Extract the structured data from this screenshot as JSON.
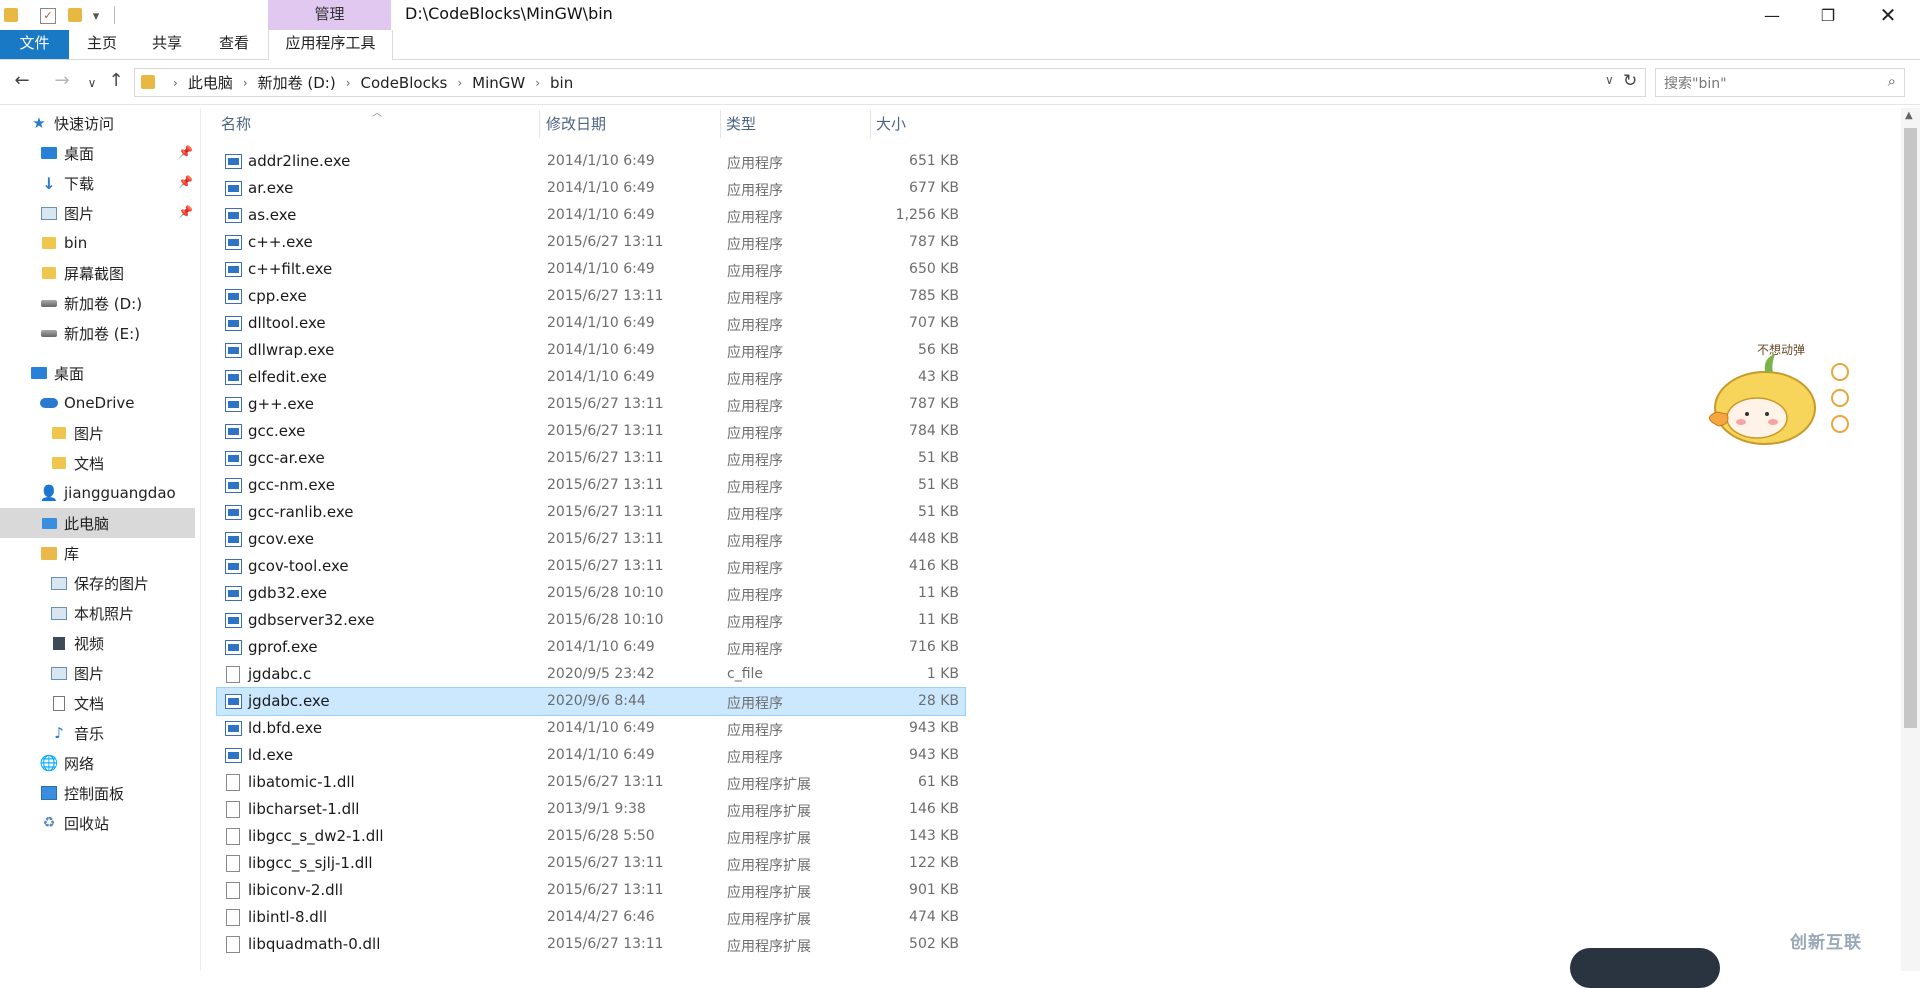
{
  "window": {
    "title": "D:\\CodeBlocks\\MinGW\\bin",
    "manage_tab": "管理"
  },
  "ribbon": {
    "tabs": [
      "文件",
      "主页",
      "共享",
      "查看",
      "应用程序工具"
    ]
  },
  "address": {
    "crumbs": [
      "此电脑",
      "新加卷 (D:)",
      "CodeBlocks",
      "MinGW",
      "bin"
    ],
    "search_placeholder": "搜索\"bin\""
  },
  "sidebar": {
    "items": [
      {
        "label": "快速访问",
        "icon": "star-icon"
      },
      {
        "label": "桌面",
        "icon": "desktop-icon",
        "pinned": true
      },
      {
        "label": "下载",
        "icon": "download-icon",
        "pinned": true
      },
      {
        "label": "图片",
        "icon": "pictures-icon",
        "pinned": true
      },
      {
        "label": "bin",
        "icon": "folder-icon"
      },
      {
        "label": "屏幕截图",
        "icon": "folder-icon"
      },
      {
        "label": "新加卷 (D:)",
        "icon": "drive-icon"
      },
      {
        "label": "新加卷 (E:)",
        "icon": "drive-icon"
      },
      {
        "label": "桌面",
        "icon": "desktop-icon"
      },
      {
        "label": "OneDrive",
        "icon": "cloud-icon"
      },
      {
        "label": "图片",
        "icon": "folder-icon"
      },
      {
        "label": "文档",
        "icon": "folder-icon"
      },
      {
        "label": "jiangguangdao",
        "icon": "user-icon"
      },
      {
        "label": "此电脑",
        "icon": "computer-icon",
        "selected": true
      },
      {
        "label": "库",
        "icon": "library-icon"
      },
      {
        "label": "保存的图片",
        "icon": "pictures-icon"
      },
      {
        "label": "本机照片",
        "icon": "pictures-icon"
      },
      {
        "label": "视频",
        "icon": "video-icon"
      },
      {
        "label": "图片",
        "icon": "pictures-icon"
      },
      {
        "label": "文档",
        "icon": "document-icon"
      },
      {
        "label": "音乐",
        "icon": "music-icon"
      },
      {
        "label": "网络",
        "icon": "network-icon"
      },
      {
        "label": "控制面板",
        "icon": "control-panel-icon"
      },
      {
        "label": "回收站",
        "icon": "recycle-bin-icon"
      }
    ]
  },
  "columns": {
    "name": "名称",
    "date": "修改日期",
    "type": "类型",
    "size": "大小"
  },
  "files": [
    {
      "name": "addr2line.exe",
      "date": "2014/1/10 6:49",
      "type": "应用程序",
      "size": "651 KB",
      "kind": "exe"
    },
    {
      "name": "ar.exe",
      "date": "2014/1/10 6:49",
      "type": "应用程序",
      "size": "677 KB",
      "kind": "exe"
    },
    {
      "name": "as.exe",
      "date": "2014/1/10 6:49",
      "type": "应用程序",
      "size": "1,256 KB",
      "kind": "exe"
    },
    {
      "name": "c++.exe",
      "date": "2015/6/27 13:11",
      "type": "应用程序",
      "size": "787 KB",
      "kind": "exe"
    },
    {
      "name": "c++filt.exe",
      "date": "2014/1/10 6:49",
      "type": "应用程序",
      "size": "650 KB",
      "kind": "exe"
    },
    {
      "name": "cpp.exe",
      "date": "2015/6/27 13:11",
      "type": "应用程序",
      "size": "785 KB",
      "kind": "exe"
    },
    {
      "name": "dlltool.exe",
      "date": "2014/1/10 6:49",
      "type": "应用程序",
      "size": "707 KB",
      "kind": "exe"
    },
    {
      "name": "dllwrap.exe",
      "date": "2014/1/10 6:49",
      "type": "应用程序",
      "size": "56 KB",
      "kind": "exe"
    },
    {
      "name": "elfedit.exe",
      "date": "2014/1/10 6:49",
      "type": "应用程序",
      "size": "43 KB",
      "kind": "exe"
    },
    {
      "name": "g++.exe",
      "date": "2015/6/27 13:11",
      "type": "应用程序",
      "size": "787 KB",
      "kind": "exe"
    },
    {
      "name": "gcc.exe",
      "date": "2015/6/27 13:11",
      "type": "应用程序",
      "size": "784 KB",
      "kind": "exe"
    },
    {
      "name": "gcc-ar.exe",
      "date": "2015/6/27 13:11",
      "type": "应用程序",
      "size": "51 KB",
      "kind": "exe"
    },
    {
      "name": "gcc-nm.exe",
      "date": "2015/6/27 13:11",
      "type": "应用程序",
      "size": "51 KB",
      "kind": "exe"
    },
    {
      "name": "gcc-ranlib.exe",
      "date": "2015/6/27 13:11",
      "type": "应用程序",
      "size": "51 KB",
      "kind": "exe"
    },
    {
      "name": "gcov.exe",
      "date": "2015/6/27 13:11",
      "type": "应用程序",
      "size": "448 KB",
      "kind": "exe"
    },
    {
      "name": "gcov-tool.exe",
      "date": "2015/6/27 13:11",
      "type": "应用程序",
      "size": "416 KB",
      "kind": "exe"
    },
    {
      "name": "gdb32.exe",
      "date": "2015/6/28 10:10",
      "type": "应用程序",
      "size": "11 KB",
      "kind": "exe"
    },
    {
      "name": "gdbserver32.exe",
      "date": "2015/6/28 10:10",
      "type": "应用程序",
      "size": "11 KB",
      "kind": "exe"
    },
    {
      "name": "gprof.exe",
      "date": "2014/1/10 6:49",
      "type": "应用程序",
      "size": "716 KB",
      "kind": "exe"
    },
    {
      "name": "jgdabc.c",
      "date": "2020/9/5 23:42",
      "type": "c_file",
      "size": "1 KB",
      "kind": "doc"
    },
    {
      "name": "jgdabc.exe",
      "date": "2020/9/6 8:44",
      "type": "应用程序",
      "size": "28 KB",
      "kind": "exe",
      "selected": true
    },
    {
      "name": "ld.bfd.exe",
      "date": "2014/1/10 6:49",
      "type": "应用程序",
      "size": "943 KB",
      "kind": "exe"
    },
    {
      "name": "ld.exe",
      "date": "2014/1/10 6:49",
      "type": "应用程序",
      "size": "943 KB",
      "kind": "exe"
    },
    {
      "name": "libatomic-1.dll",
      "date": "2015/6/27 13:11",
      "type": "应用程序扩展",
      "size": "61 KB",
      "kind": "doc"
    },
    {
      "name": "libcharset-1.dll",
      "date": "2013/9/1 9:38",
      "type": "应用程序扩展",
      "size": "146 KB",
      "kind": "doc"
    },
    {
      "name": "libgcc_s_dw2-1.dll",
      "date": "2015/6/28 5:50",
      "type": "应用程序扩展",
      "size": "143 KB",
      "kind": "doc"
    },
    {
      "name": "libgcc_s_sjlj-1.dll",
      "date": "2015/6/27 13:11",
      "type": "应用程序扩展",
      "size": "122 KB",
      "kind": "doc"
    },
    {
      "name": "libiconv-2.dll",
      "date": "2015/6/27 13:11",
      "type": "应用程序扩展",
      "size": "901 KB",
      "kind": "doc"
    },
    {
      "name": "libintl-8.dll",
      "date": "2014/4/27 6:46",
      "type": "应用程序扩展",
      "size": "474 KB",
      "kind": "doc"
    },
    {
      "name": "libquadmath-0.dll",
      "date": "2015/6/27 13:11",
      "type": "应用程序扩展",
      "size": "502 KB",
      "kind": "doc"
    }
  ],
  "decor": {
    "sticker_text": "不想动弹",
    "watermark": "创新互联"
  }
}
